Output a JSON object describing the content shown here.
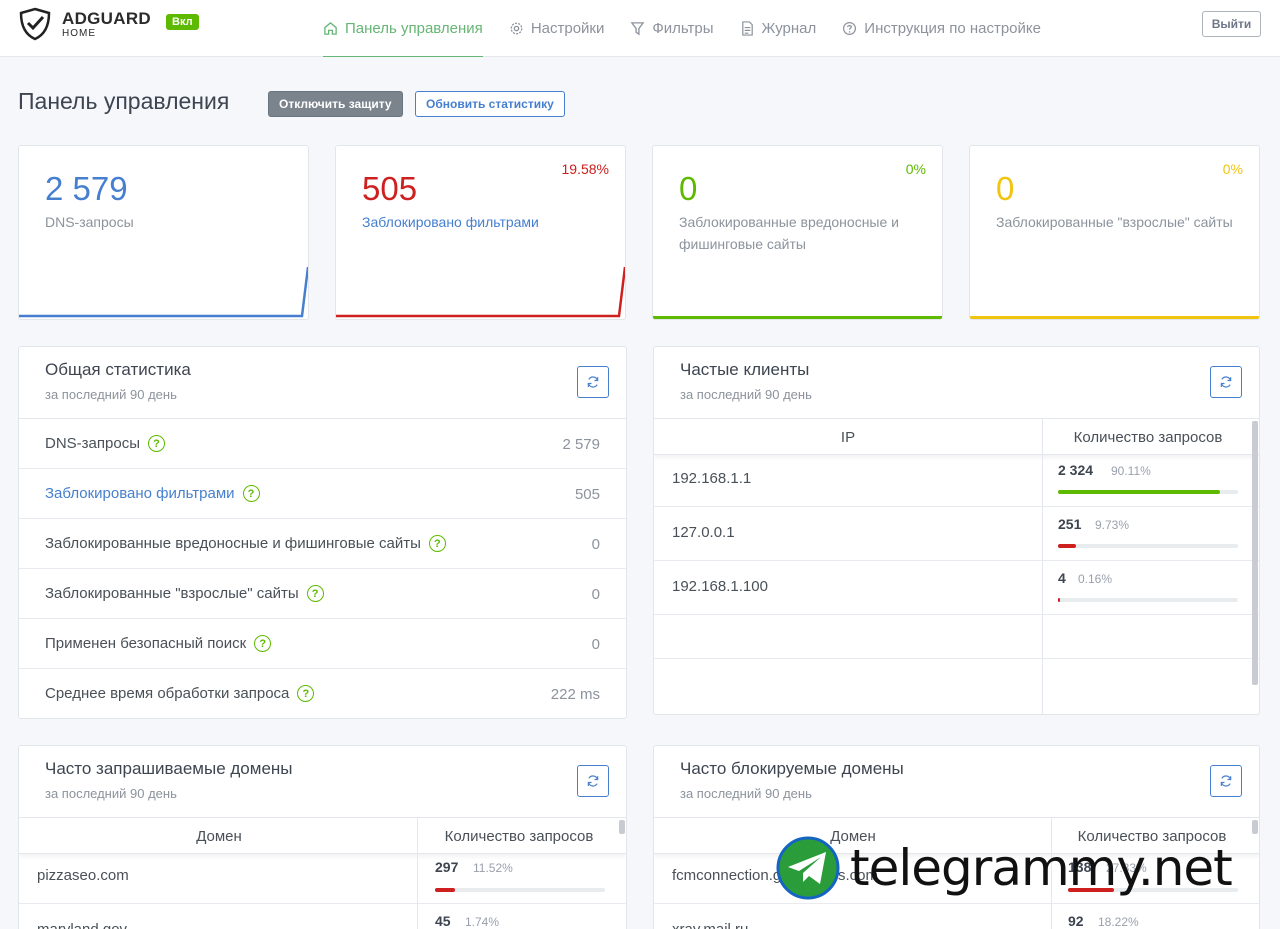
{
  "header": {
    "brand": "ADGUARD",
    "brand_sub": "HOME",
    "status_badge": "Вкл",
    "nav": [
      {
        "label": "Панель управления",
        "icon": "home-icon"
      },
      {
        "label": "Настройки",
        "icon": "gear-icon"
      },
      {
        "label": "Фильтры",
        "icon": "filter-icon"
      },
      {
        "label": "Журнал",
        "icon": "document-icon"
      },
      {
        "label": "Инструкция по настройке",
        "icon": "help-icon"
      }
    ],
    "logout_label": "Выйти"
  },
  "page": {
    "title": "Панель управления",
    "disable_label": "Отключить защиту",
    "refresh_label": "Обновить статистику"
  },
  "stats": [
    {
      "value": "2 579",
      "label": "DNS-запросы",
      "percent": "",
      "color": "#467fcf"
    },
    {
      "value": "505",
      "label": "Заблокировано фильтрами",
      "percent": "19.58%",
      "color": "#cd201f"
    },
    {
      "value": "0",
      "label": "Заблокированные вредоносные и фишинговые сайты",
      "percent": "0%",
      "color": "#5eba00"
    },
    {
      "value": "0",
      "label": "Заблокированные \"взрослые\" сайты",
      "percent": "0%",
      "color": "#f1c40f"
    }
  ],
  "general": {
    "title": "Общая статистика",
    "subtitle": "за последний 90 день",
    "rows": [
      {
        "label": "DNS-запросы",
        "value": "2 579"
      },
      {
        "label": "Заблокировано фильтрами",
        "value": "505"
      },
      {
        "label": "Заблокированные вредоносные и фишинговые сайты",
        "value": "0"
      },
      {
        "label": "Заблокированные \"взрослые\" сайты",
        "value": "0"
      },
      {
        "label": "Применен безопасный поиск",
        "value": "0"
      },
      {
        "label": "Среднее время обработки запроса",
        "value": "222 ms"
      }
    ]
  },
  "clients": {
    "title": "Частые клиенты",
    "subtitle": "за последний 90 день",
    "col_ip": "IP",
    "col_count": "Количество запросов",
    "rows": [
      {
        "ip": "192.168.1.1",
        "count": "2 324",
        "percent": "90.11%",
        "fraction": 0.9011,
        "color": "#5eba00"
      },
      {
        "ip": "127.0.0.1",
        "count": "251",
        "percent": "9.73%",
        "fraction": 0.0973,
        "color": "#cd201f"
      },
      {
        "ip": "192.168.1.100",
        "count": "4",
        "percent": "0.16%",
        "fraction": 0.0016,
        "color": "#cd201f"
      }
    ]
  },
  "queried": {
    "title": "Часто запрашиваемые домены",
    "subtitle": "за последний 90 день",
    "col_domain": "Домен",
    "col_count": "Количество запросов",
    "rows": [
      {
        "domain": "pizzaseo.com",
        "count": "297",
        "percent": "11.52%",
        "fraction": 0.1152,
        "color": "#cd201f"
      },
      {
        "domain": "maryland.gov",
        "count": "45",
        "percent": "1.74%",
        "fraction": 0.0174,
        "color": "#cd201f"
      }
    ]
  },
  "blocked": {
    "title": "Часто блокируемые домены",
    "subtitle": "за последний 90 день",
    "col_domain": "Домен",
    "col_count": "Количество запросов",
    "rows": [
      {
        "domain": "fcmconnection.googleapis.com",
        "count": "138",
        "percent": "27.33%",
        "fraction": 0.2733,
        "color": "#cd201f"
      },
      {
        "domain": "xray.mail.ru",
        "count": "92",
        "percent": "18.22%",
        "fraction": 0.1822,
        "color": "#cd201f"
      }
    ]
  },
  "watermark": "telegrammy.net"
}
